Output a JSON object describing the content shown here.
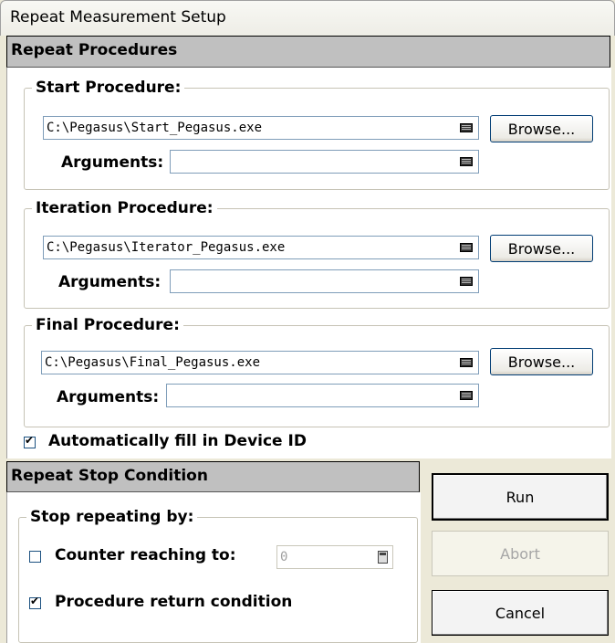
{
  "window": {
    "title": "Repeat Measurement Setup"
  },
  "repeat_procedures": {
    "header": "Repeat Procedures",
    "start": {
      "legend": "Start Procedure:",
      "path": "C:\\Pegasus\\Start_Pegasus.exe",
      "browse_label": "Browse...",
      "arguments_label": "Arguments:",
      "arguments_value": ""
    },
    "iteration": {
      "legend": "Iteration Procedure:",
      "path": "C:\\Pegasus\\Iterator_Pegasus.exe",
      "browse_label": "Browse...",
      "arguments_label": "Arguments:",
      "arguments_value": ""
    },
    "final": {
      "legend": "Final Procedure:",
      "path": "C:\\Pegasus\\Final_Pegasus.exe",
      "browse_label": "Browse...",
      "arguments_label": "Arguments:",
      "arguments_value": ""
    },
    "auto_fill": {
      "label": "Automatically fill in Device ID",
      "checked": true
    }
  },
  "stop_condition": {
    "header": "Repeat Stop Condition",
    "group_legend": "Stop repeating by:",
    "counter": {
      "label": "Counter reaching to:",
      "checked": false,
      "value": "0"
    },
    "procedure_return": {
      "label": "Procedure return condition",
      "checked": true
    }
  },
  "buttons": {
    "run": "Run",
    "abort": "Abort",
    "cancel": "Cancel"
  }
}
